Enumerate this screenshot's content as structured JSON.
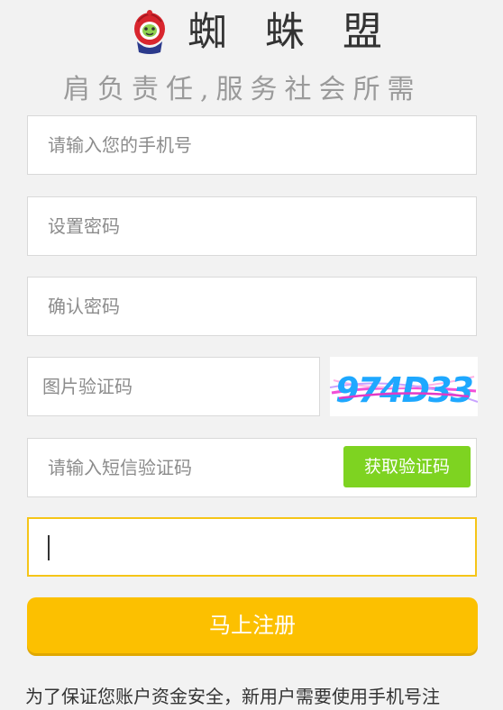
{
  "header": {
    "logo_icon": "spider-hero-mascot-icon",
    "brand": "蜘 蛛 盟",
    "slogan": "肩负责任,服务社会所需"
  },
  "form": {
    "phone_placeholder": "请输入您的手机号",
    "password_placeholder": "设置密码",
    "confirm_placeholder": "确认密码",
    "image_code_placeholder": "图片验证码",
    "captcha_text": "974D33",
    "sms_code_placeholder": "请输入短信验证码",
    "get_code_label": "获取验证码",
    "active_field_value": "",
    "submit_label": "马上注册"
  },
  "notice": "为了保证您账户资金安全，新用户需要使用手机号注",
  "colors": {
    "background": "#f2f2f2",
    "submit_button": "#fcc000",
    "sms_button": "#7ed321",
    "active_border": "#f5c518"
  }
}
